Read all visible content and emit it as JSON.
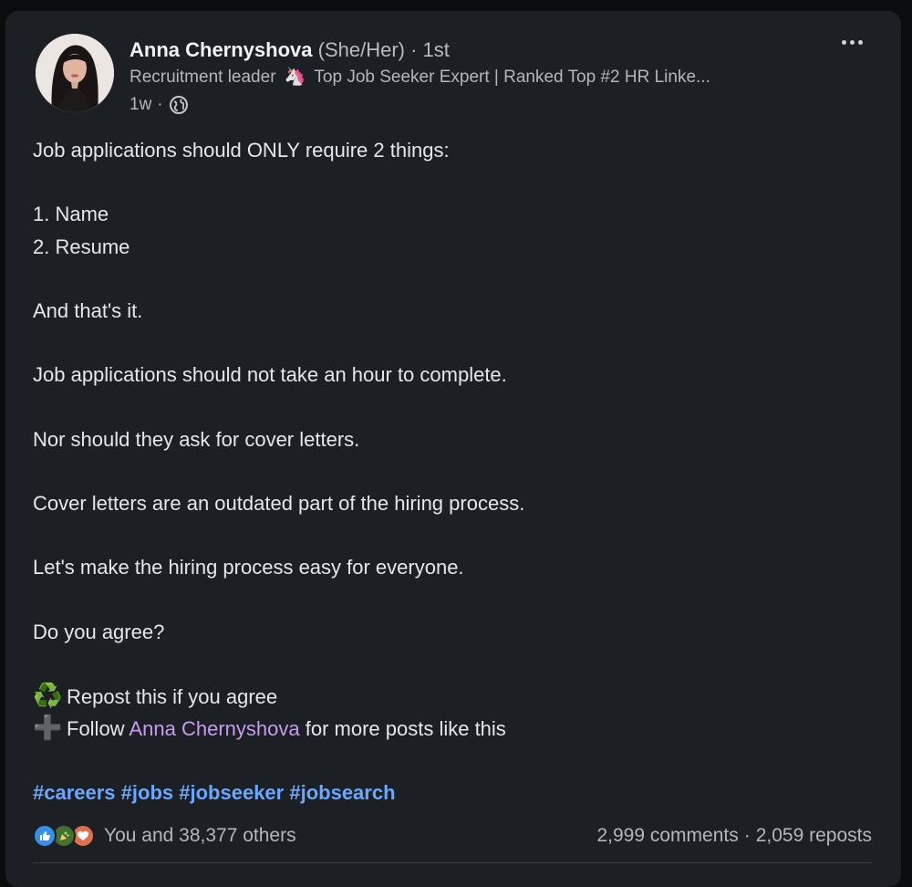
{
  "author": {
    "name": "Anna Chernyshova",
    "pronouns": "(She/Her)",
    "degree": "· 1st",
    "headline_prefix": "Recruitment leader",
    "headline_emoji": "🦄",
    "headline_rest": "Top Job Seeker Expert | Ranked Top #2 HR Linke...",
    "post_age": "1w",
    "meta_separator": "·",
    "visibility_icon": "globe-icon"
  },
  "menu": {
    "icon": "more-horizontal-icon"
  },
  "post": {
    "lines": [
      "Job applications should ONLY require 2 things:",
      "",
      "1. Name",
      "2. Resume",
      "",
      "And that's it.",
      "",
      "Job applications should not take an hour to complete.",
      "",
      "Nor should they ask for cover letters.",
      "",
      "Cover letters are an outdated part of the hiring process.",
      "",
      "Let's make the hiring process easy for everyone.",
      "",
      "Do you agree?",
      ""
    ],
    "cta_repost": {
      "icon": "♻️",
      "text": "Repost this if you agree"
    },
    "cta_follow": {
      "icon": "➕",
      "prefix": "Follow",
      "mention": "Anna Chernyshova",
      "suffix": "for more posts like this"
    },
    "hashtags": [
      "#careers",
      "#jobs",
      "#jobseeker",
      "#jobsearch"
    ]
  },
  "social": {
    "reactions_text": "You and 38,377 others",
    "comments": "2,999 comments",
    "separator": "·",
    "reposts": "2,059 reposts",
    "reaction_icons": [
      "like-icon",
      "celebrate-icon",
      "love-icon"
    ]
  },
  "colors": {
    "card_background": "#1c1f23",
    "hashtag": "#6aa7ff",
    "mention": "#c79cf0",
    "like": "#378fe9",
    "celebrate": "#44712e",
    "love": "#df704d"
  }
}
